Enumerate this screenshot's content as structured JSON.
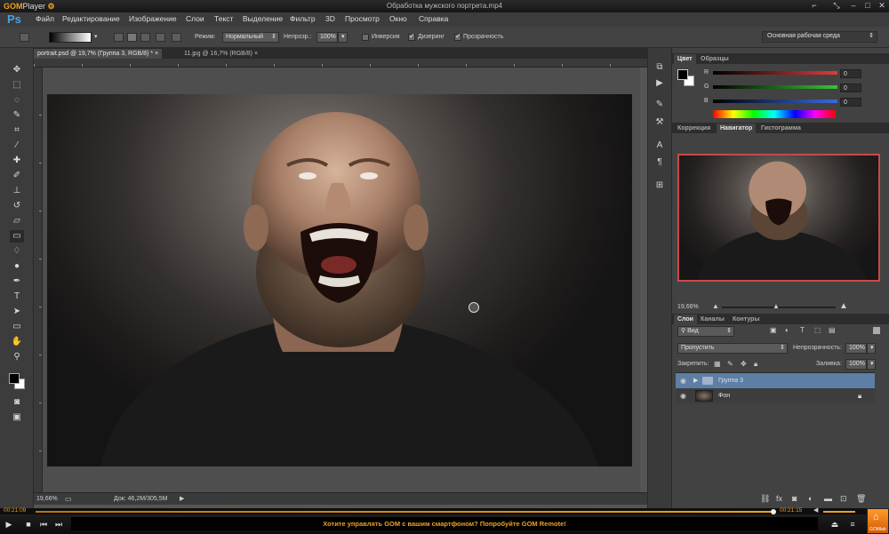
{
  "gom": {
    "logo_a": "GOM",
    "logo_b": "Player",
    "window_title": "Обработка мужского портрета.mp4",
    "time_current": "00:21:09",
    "time_total": "00:21:15",
    "promo_message": "Хотите управлять GOM с вашим смартфоном? Попробуйте GOM Remote!",
    "button_label": "GOMlab",
    "accent_color": "#f0a020"
  },
  "menubar": {
    "logo": "Ps",
    "items": [
      "Файл",
      "Редактирование",
      "Изображение",
      "Слои",
      "Текст",
      "Выделение",
      "Фильтр",
      "3D",
      "Просмотр",
      "Окно",
      "Справка"
    ]
  },
  "options": {
    "mode_label": "Режим:",
    "mode_value": "Нормальный",
    "opacity_label": "Непрозр.:",
    "opacity_value": "100%",
    "inversion_label": "Инверсия",
    "inversion_checked": false,
    "dither_label": "Дизеринг",
    "dither_checked": true,
    "transparency_label": "Прозрачность",
    "transparency_checked": true,
    "workspace": "Основная рабочая среда"
  },
  "documents": {
    "tabs": [
      "portrait.psd @ 19,7% (Группа 3, RGB/8) *",
      "11.jpg @ 16,7% (RGB/8)"
    ],
    "active_tab": 0
  },
  "status": {
    "zoom": "19,66%",
    "doc_size": "Док: 46,2M/305,5M"
  },
  "color_panel": {
    "tabs": [
      "Цвет",
      "Образцы"
    ],
    "channels": [
      {
        "label": "R",
        "value": "0",
        "color": "#e23a3a"
      },
      {
        "label": "G",
        "value": "0",
        "color": "#3ac23a"
      },
      {
        "label": "B",
        "value": "0",
        "color": "#3a6ae2"
      }
    ]
  },
  "navigator_panel": {
    "tabs": [
      "Коррекция",
      "Навигатор",
      "Гистограмма"
    ],
    "zoom": "19,66%"
  },
  "layers_panel": {
    "tabs": [
      "Слои",
      "Каналы",
      "Контуры"
    ],
    "filter_label": "Вид",
    "blend_mode": "Пропустить",
    "opacity_label": "Непрозрачность:",
    "opacity_value": "100%",
    "lock_label": "Закрепить:",
    "fill_label": "Заливка:",
    "fill_value": "100%",
    "layers": [
      {
        "name": "Группа 3",
        "type": "group",
        "selected": true
      },
      {
        "name": "Фон",
        "type": "background",
        "locked": true
      }
    ]
  }
}
